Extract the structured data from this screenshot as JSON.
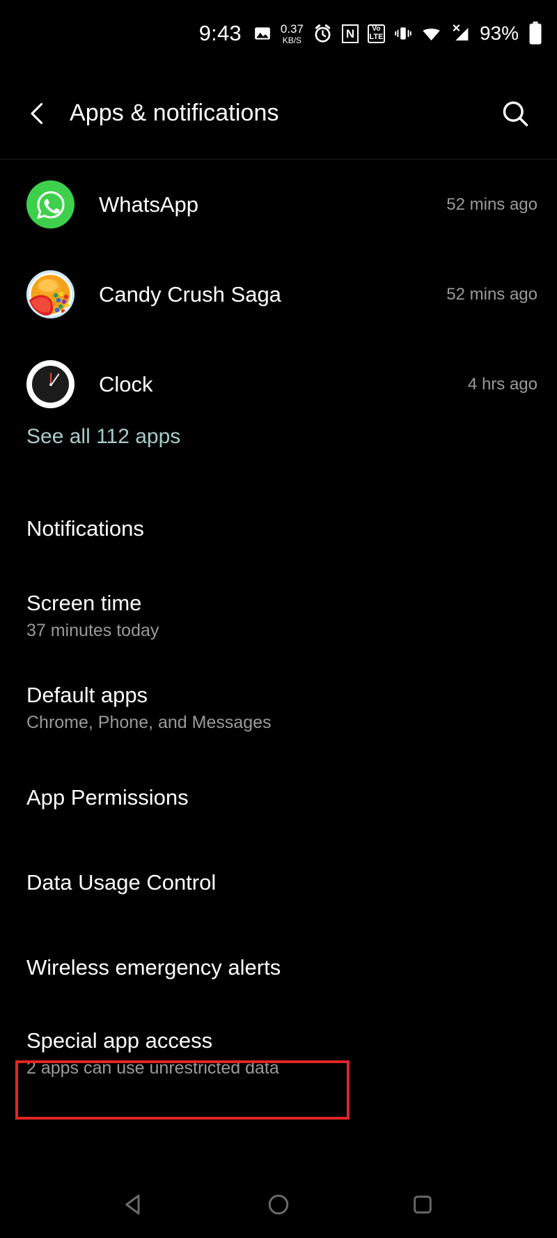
{
  "status_bar": {
    "time": "9:43",
    "icons": [
      {
        "name": "screenshot-icon",
        "label": "screenshot"
      },
      {
        "name": "data-speed-indicator",
        "value": "0.37",
        "unit": "KB/S"
      },
      {
        "name": "alarm-icon",
        "label": "alarm"
      },
      {
        "name": "nfc-icon",
        "label": "N"
      },
      {
        "name": "volte-icon",
        "top": "Vo",
        "bottom": "LTE"
      },
      {
        "name": "vibrate-icon",
        "label": "vibrate"
      },
      {
        "name": "wifi-icon",
        "label": "wifi"
      },
      {
        "name": "cellular-signal-icon",
        "label": "no-sim"
      }
    ],
    "battery_percent": "93%"
  },
  "header": {
    "back_label": "Back",
    "title": "Apps & notifications",
    "search_label": "Search"
  },
  "recent_apps": [
    {
      "name": "WhatsApp",
      "time": "52 mins ago",
      "icon": "whatsapp-icon"
    },
    {
      "name": "Candy Crush Saga",
      "time": "52 mins ago",
      "icon": "candy-crush-icon"
    },
    {
      "name": "Clock",
      "time": "4 hrs ago",
      "icon": "clock-icon"
    }
  ],
  "see_all": {
    "label": "See all 112 apps",
    "color": "#a7cdc7"
  },
  "settings_rows": [
    {
      "title": "Notifications",
      "subtitle": ""
    },
    {
      "title": "Screen time",
      "subtitle": "37 minutes today"
    },
    {
      "title": "Default apps",
      "subtitle": "Chrome, Phone, and Messages"
    },
    {
      "title": "App Permissions",
      "subtitle": ""
    },
    {
      "title": "Data Usage Control",
      "subtitle": ""
    },
    {
      "title": "Wireless emergency alerts",
      "subtitle": ""
    },
    {
      "title": "Special app access",
      "subtitle": "2 apps can use unrestricted data"
    }
  ],
  "highlight": {
    "target": "Special app access",
    "color": "#e02626"
  },
  "nav_bar": {
    "back": "back-nav-button",
    "home": "home-nav-button",
    "recents": "recents-nav-button",
    "color": "#6a6a6a"
  }
}
